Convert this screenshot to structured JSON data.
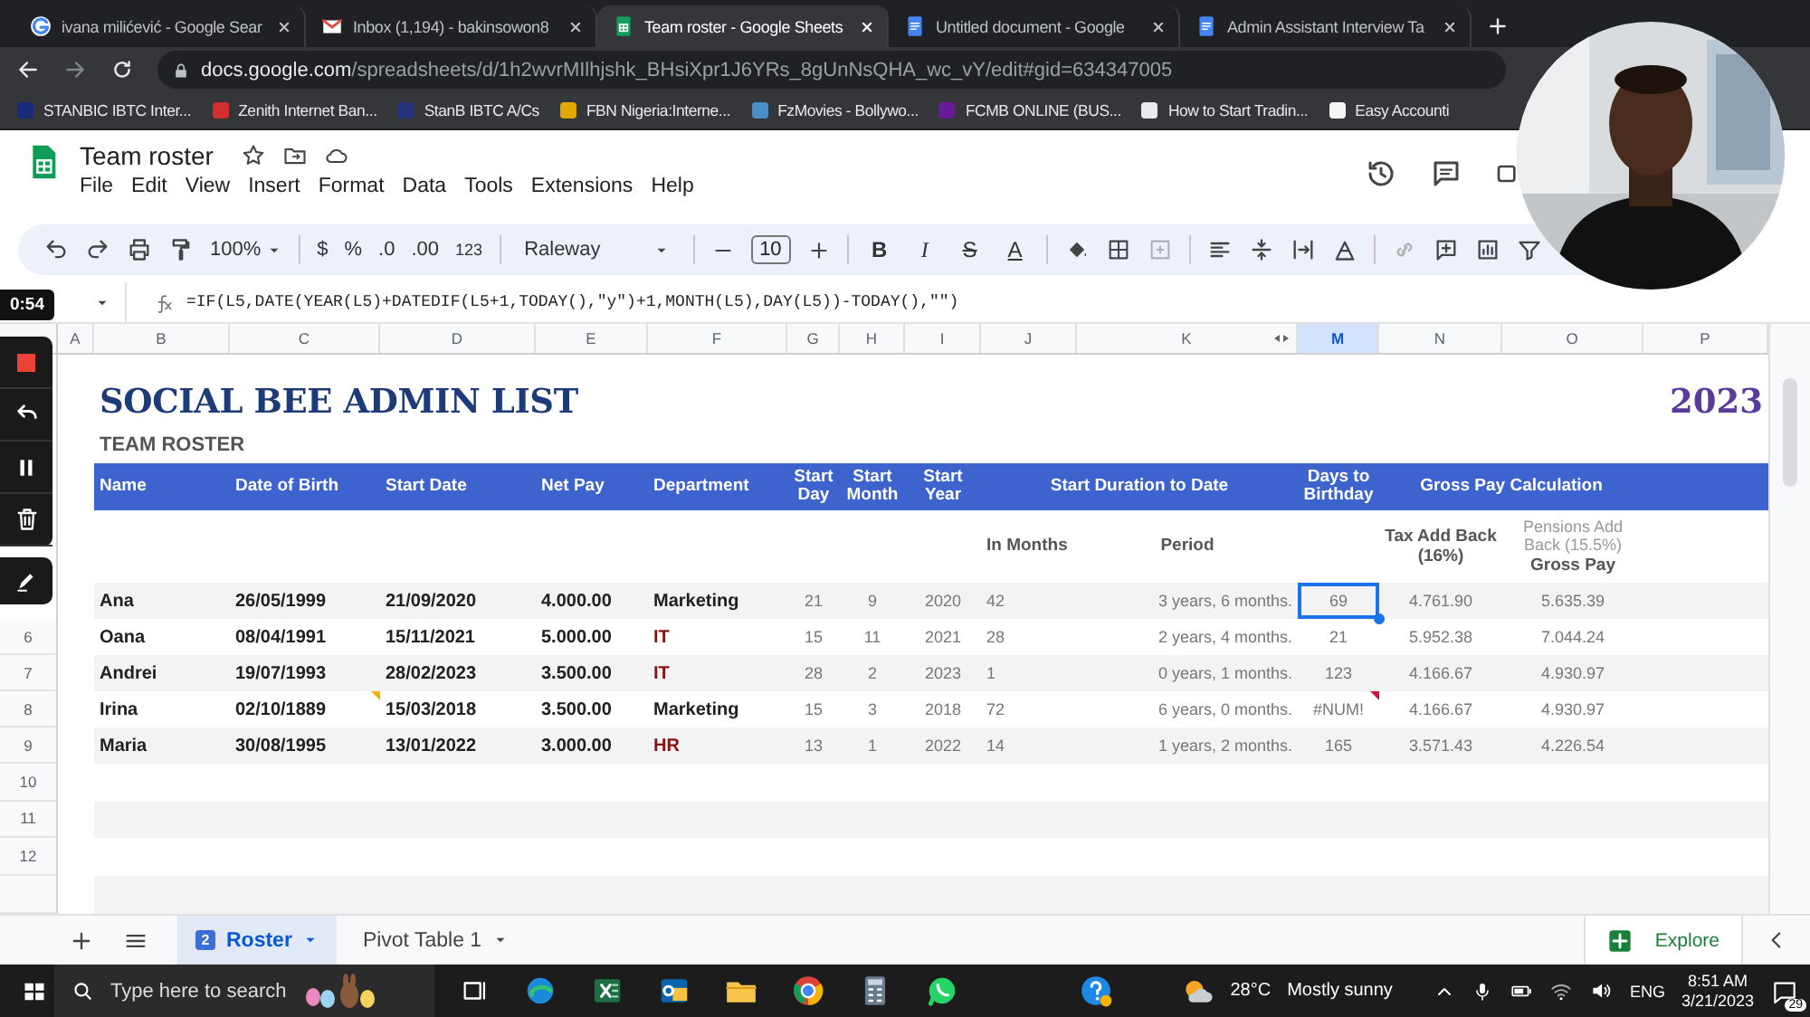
{
  "browser_tabs": [
    {
      "kind": "google",
      "title": "ivana milićević - Google Sear",
      "selected": false
    },
    {
      "kind": "gmail",
      "title": "Inbox (1,194) - bakinsowon8",
      "selected": false
    },
    {
      "kind": "sheets",
      "title": "Team roster - Google Sheets",
      "selected": true
    },
    {
      "kind": "docs",
      "title": "Untitled document - Google",
      "selected": false
    },
    {
      "kind": "docs",
      "title": "Admin Assistant Interview Ta",
      "selected": false
    }
  ],
  "address_bar": {
    "host": "docs.google.com",
    "path": "/spreadsheets/d/1h2wvrMIlhjshk_BHsiXpr1J6YRs_8gUnNsQHA_wc_vY/edit#gid=634347005"
  },
  "bookmarks": [
    {
      "label": "STANBIC IBTC Inter...",
      "color": "#1a2a7a"
    },
    {
      "label": "Zenith Internet Ban...",
      "color": "#d32f2f"
    },
    {
      "label": "StanB IBTC A/Cs",
      "color": "#23307a"
    },
    {
      "label": "FBN Nigeria:Interne...",
      "color": "#e0a800"
    },
    {
      "label": "FzMovies - Bollywo...",
      "color": "#4a90c8"
    },
    {
      "label": "FCMB ONLINE (BUS...",
      "color": "#6a1b9a"
    },
    {
      "label": "How to Start Tradin...",
      "color": "#e8eaed"
    },
    {
      "label": "Easy Accounti",
      "color": "#f5f5f5"
    }
  ],
  "document": {
    "title": "Team roster",
    "menus": [
      "File",
      "Edit",
      "View",
      "Insert",
      "Format",
      "Data",
      "Tools",
      "Extensions",
      "Help"
    ]
  },
  "toolbar": {
    "zoom": "100%",
    "currency": "$",
    "percent": "%",
    "decrease_decimals": ".0",
    "increase_decimals": ".00",
    "number_format": "123",
    "font": "Raleway",
    "font_size": "10",
    "text_format": [
      "B",
      "I",
      "S",
      "A"
    ]
  },
  "recorder": {
    "time": "0:54"
  },
  "formula_bar": {
    "formula": "=IF(L5,DATE(YEAR(L5)+DATEDIF(L5+1,TODAY(),\"y\")+1,MONTH(L5),DAY(L5))-TODAY(),\"\")"
  },
  "columns": [
    {
      "label": "A",
      "selected": false
    },
    {
      "label": "B",
      "selected": false
    },
    {
      "label": "C",
      "selected": false
    },
    {
      "label": "D",
      "selected": false
    },
    {
      "label": "E",
      "selected": false
    },
    {
      "label": "F",
      "selected": false
    },
    {
      "label": "G",
      "selected": false
    },
    {
      "label": "H",
      "selected": false
    },
    {
      "label": "I",
      "selected": false
    },
    {
      "label": "J",
      "selected": false
    },
    {
      "label": "K",
      "selected": false
    },
    {
      "label": "M",
      "selected": true
    },
    {
      "label": "N",
      "selected": false
    },
    {
      "label": "O",
      "selected": false
    },
    {
      "label": "P",
      "selected": false
    }
  ],
  "row_numbers": [
    "6",
    "7",
    "8",
    "9",
    "10",
    "11",
    "12"
  ],
  "sheet": {
    "title": "SOCIAL BEE ADMIN LIST",
    "year": "2023",
    "subtitle": "TEAM ROSTER",
    "headers": [
      "Name",
      "Date of Birth",
      "Start Date",
      "Net Pay",
      "Department",
      "Start Day",
      "Start Month",
      "Start Year",
      "Start Duration to Date",
      "Days to Birthday",
      "Gross Pay Calculation"
    ],
    "subheaders": {
      "in_months": "In Months",
      "period": "Period",
      "tax_add_back": "Tax Add Back (16%)",
      "pensions_add_back": "Pensions Add Back (15.5%)",
      "gross_pay": "Gross Pay"
    },
    "rows": [
      {
        "name": "Ana",
        "date_of_birth": "26/05/1999",
        "note": false,
        "start_date": "21/09/2020",
        "net_pay": "4.000.00",
        "department": {
          "text": "Marketing",
          "color": "#202020"
        },
        "start_day": "21",
        "start_month": "9",
        "start_year": "2020",
        "in_months": "42",
        "period": "3 years, 6 months.",
        "days_to_birthday": "69",
        "selected": true,
        "error": false,
        "tax_add_back": "4.761.90",
        "gross_pay": "5.635.39"
      },
      {
        "name": "Oana",
        "date_of_birth": "08/04/1991",
        "note": false,
        "start_date": "15/11/2021",
        "net_pay": "5.000.00",
        "department": {
          "text": "IT",
          "color": "#8b1010"
        },
        "start_day": "15",
        "start_month": "11",
        "start_year": "2021",
        "in_months": "28",
        "period": "2 years, 4 months.",
        "days_to_birthday": "21",
        "selected": false,
        "error": false,
        "tax_add_back": "5.952.38",
        "gross_pay": "7.044.24"
      },
      {
        "name": "Andrei",
        "date_of_birth": "19/07/1993",
        "note": false,
        "start_date": "28/02/2023",
        "net_pay": "3.500.00",
        "department": {
          "text": "IT",
          "color": "#8b1010"
        },
        "start_day": "28",
        "start_month": "2",
        "start_year": "2023",
        "in_months": "1",
        "period": "0 years, 1 months.",
        "days_to_birthday": "123",
        "selected": false,
        "error": false,
        "tax_add_back": "4.166.67",
        "gross_pay": "4.930.97"
      },
      {
        "name": "Irina",
        "date_of_birth": "02/10/1889",
        "note": true,
        "start_date": "15/03/2018",
        "net_pay": "3.500.00",
        "department": {
          "text": "Marketing",
          "color": "#202020"
        },
        "start_day": "15",
        "start_month": "3",
        "start_year": "2018",
        "in_months": "72",
        "period": "6 years, 0 months.",
        "days_to_birthday": "#NUM!",
        "selected": false,
        "error": true,
        "tax_add_back": "4.166.67",
        "gross_pay": "4.930.97"
      },
      {
        "name": "Maria",
        "date_of_birth": "30/08/1995",
        "note": false,
        "start_date": "13/01/2022",
        "net_pay": "3.000.00",
        "department": {
          "text": "HR",
          "color": "#8b1010"
        },
        "start_day": "13",
        "start_month": "1",
        "start_year": "2022",
        "in_months": "14",
        "period": "1 years, 2 months.",
        "days_to_birthday": "165",
        "selected": false,
        "error": false,
        "tax_add_back": "3.571.43",
        "gross_pay": "4.226.54"
      }
    ]
  },
  "sheet_tabs": [
    {
      "label": "Roster",
      "badge": "2",
      "selected": true
    },
    {
      "label": "Pivot Table 1",
      "selected": false
    }
  ],
  "explore": "Explore",
  "taskbar": {
    "search_placeholder": "Type here to search",
    "temperature": "28°C",
    "weather": "Mostly sunny",
    "language": "ENG",
    "time": "8:51 AM",
    "date": "3/21/2023",
    "notifications": "29"
  }
}
